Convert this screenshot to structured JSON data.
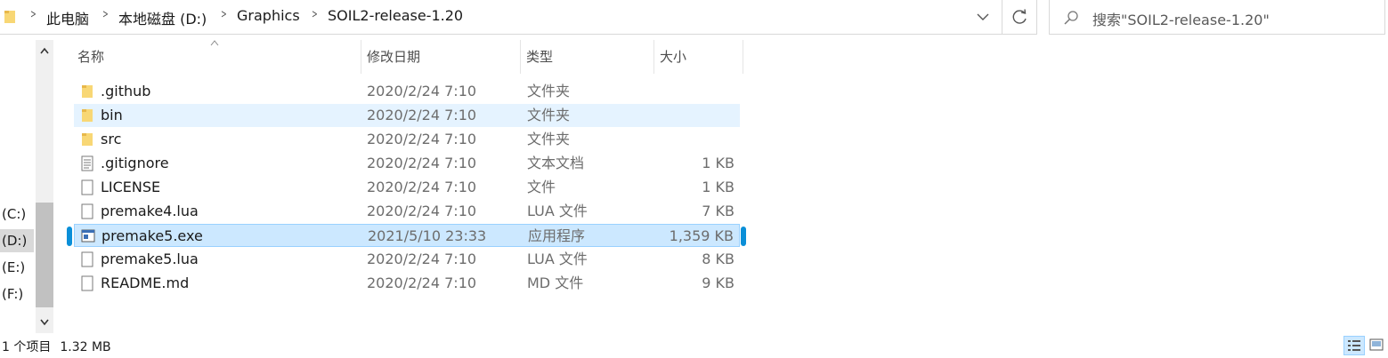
{
  "address": {
    "crumbs": [
      "此电脑",
      "本地磁盘 (D:)",
      "Graphics",
      "SOIL2-release-1.20"
    ],
    "icons": [
      "folder-icon",
      "chevron-right-icon",
      "chevron-down-icon",
      "refresh-icon"
    ]
  },
  "search": {
    "placeholder": "搜索\"SOIL2-release-1.20\"",
    "icon": "search-icon"
  },
  "nav": {
    "drives": [
      "(C:)",
      "(D:)",
      "(E:)",
      "(F:)"
    ],
    "selected": "(D:)"
  },
  "columns": {
    "name": "名称",
    "date": "修改日期",
    "type": "类型",
    "size": "大小"
  },
  "files": [
    {
      "name": ".github",
      "date": "2020/2/24 7:10",
      "type": "文件夹",
      "size": "",
      "icon": "folder-icon"
    },
    {
      "name": "bin",
      "date": "2020/2/24 7:10",
      "type": "文件夹",
      "size": "",
      "icon": "folder-icon"
    },
    {
      "name": "src",
      "date": "2020/2/24 7:10",
      "type": "文件夹",
      "size": "",
      "icon": "folder-icon"
    },
    {
      "name": ".gitignore",
      "date": "2020/2/24 7:10",
      "type": "文本文档",
      "size": "1 KB",
      "icon": "text-file-icon"
    },
    {
      "name": "LICENSE",
      "date": "2020/2/24 7:10",
      "type": "文件",
      "size": "1 KB",
      "icon": "file-icon"
    },
    {
      "name": "premake4.lua",
      "date": "2020/2/24 7:10",
      "type": "LUA 文件",
      "size": "7 KB",
      "icon": "file-icon"
    },
    {
      "name": "premake5.exe",
      "date": "2021/5/10 23:33",
      "type": "应用程序",
      "size": "1,359 KB",
      "icon": "application-icon"
    },
    {
      "name": "premake5.lua",
      "date": "2020/2/24 7:10",
      "type": "LUA 文件",
      "size": "8 KB",
      "icon": "file-icon"
    },
    {
      "name": "README.md",
      "date": "2020/2/24 7:10",
      "type": "MD 文件",
      "size": "9 KB",
      "icon": "file-icon"
    }
  ],
  "hovered_file": "bin",
  "selected_file": "premake5.exe",
  "status": {
    "count": "1 个项目",
    "size": "1.32 MB"
  },
  "colors": {
    "selection": "#cce8ff",
    "selection_border": "#99d1ff",
    "hover": "#e5f3ff",
    "marker": "#0a8fd8",
    "folder": "#f8d775"
  }
}
